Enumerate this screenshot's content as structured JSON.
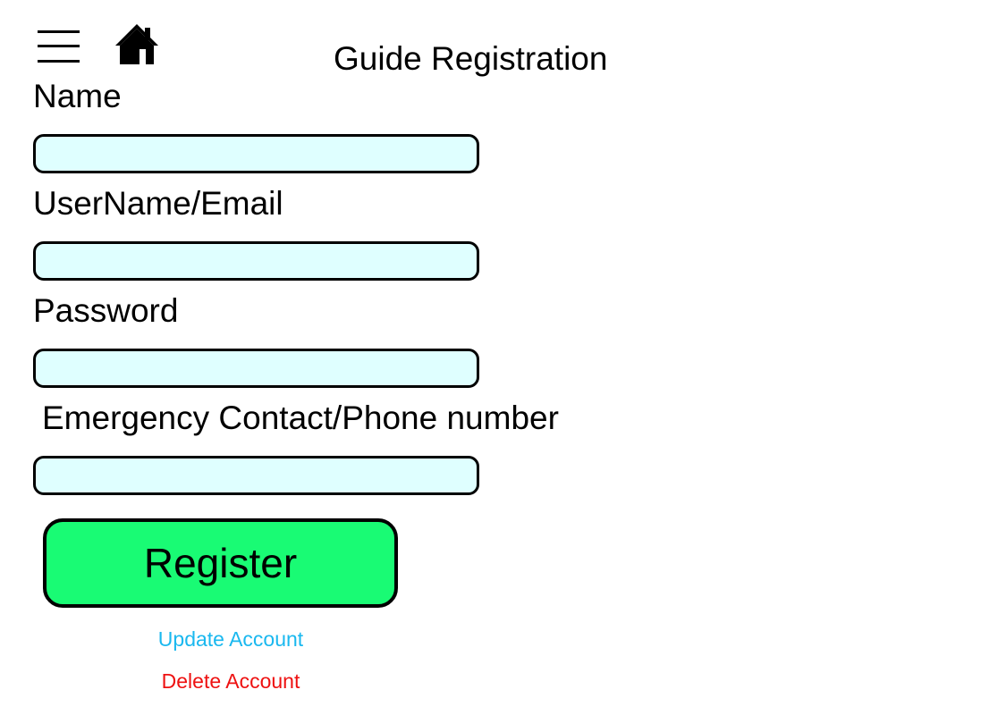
{
  "header": {
    "title": "Guide Registration",
    "menu_icon": "hamburger-menu-icon",
    "home_icon": "home-icon"
  },
  "form": {
    "fields": [
      {
        "label": "Name",
        "value": "",
        "placeholder": ""
      },
      {
        "label": "UserName/Email",
        "value": "",
        "placeholder": ""
      },
      {
        "label": "Password",
        "value": "",
        "placeholder": ""
      },
      {
        "label": "Emergency Contact/Phone number",
        "value": "",
        "placeholder": ""
      }
    ],
    "register_label": "Register"
  },
  "links": {
    "update_label": "Update Account",
    "delete_label": "Delete Account"
  },
  "colors": {
    "input_background": "#dfffff",
    "register_background": "#19fb74",
    "update_link": "#1ab8ef",
    "delete_link": "#ee1111",
    "border": "#000000"
  }
}
